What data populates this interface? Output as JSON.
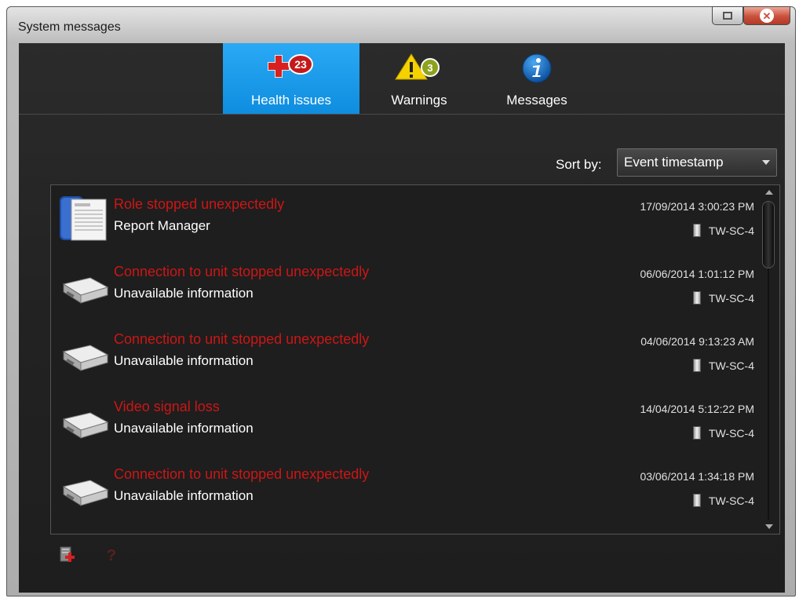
{
  "window": {
    "title": "System messages"
  },
  "tabs": [
    {
      "label": "Health issues",
      "icon": "health-plus-icon",
      "badge": "23",
      "active": true
    },
    {
      "label": "Warnings",
      "icon": "warning-triangle-icon",
      "badge": "3",
      "active": false
    },
    {
      "label": "Messages",
      "icon": "info-icon",
      "active": false
    }
  ],
  "sort": {
    "label": "Sort by:",
    "value": "Event timestamp"
  },
  "colors": {
    "accent": "#1a9be9",
    "error_text": "#cc1616"
  },
  "messages": [
    {
      "title": "Role stopped unexpectedly",
      "source": "Report Manager",
      "timestamp": "17/09/2014 3:00:23 PM",
      "server": "TW-SC-4",
      "icon": "report-document-icon"
    },
    {
      "title": "Connection to unit stopped unexpectedly",
      "source": "Unavailable information",
      "timestamp": "06/06/2014 1:01:12 PM",
      "server": "TW-SC-4",
      "icon": "video-unit-icon"
    },
    {
      "title": "Connection to unit stopped unexpectedly",
      "source": "Unavailable information",
      "timestamp": "04/06/2014 9:13:23 AM",
      "server": "TW-SC-4",
      "icon": "video-unit-icon"
    },
    {
      "title": "Video signal loss",
      "source": "Unavailable information",
      "timestamp": "14/04/2014 5:12:22 PM",
      "server": "TW-SC-4",
      "icon": "video-unit-icon"
    },
    {
      "title": "Connection to unit stopped unexpectedly",
      "source": "Unavailable information",
      "timestamp": "03/06/2014 1:34:18 PM",
      "server": "TW-SC-4",
      "icon": "video-unit-icon"
    }
  ],
  "footer": {
    "buttons": [
      "add-health-event-icon",
      "help-icon"
    ]
  }
}
